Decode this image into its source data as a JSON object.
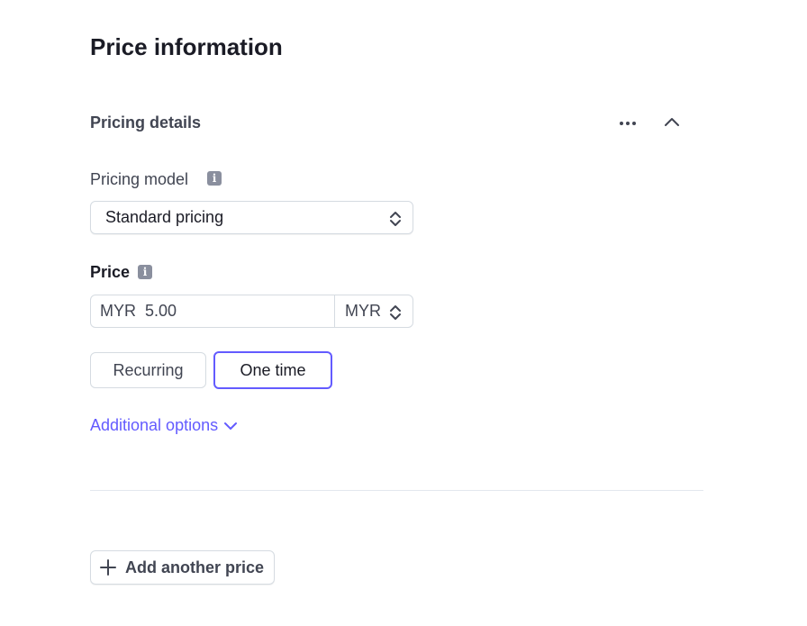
{
  "page": {
    "title": "Price information"
  },
  "pricing_details": {
    "title": "Pricing details",
    "more_icon": "ellipsis-icon",
    "collapse_icon": "chevron-up-icon"
  },
  "pricing_model": {
    "label": "Pricing model",
    "info_icon": "info-icon",
    "selected": "Standard pricing"
  },
  "price": {
    "label": "Price",
    "info_icon": "info-icon",
    "currency_prefix": "MYR",
    "amount": "5.00",
    "currency_selected": "MYR"
  },
  "billing_type": {
    "options": [
      "Recurring",
      "One time"
    ],
    "selected": "One time"
  },
  "additional_options": {
    "label": "Additional options"
  },
  "add_price": {
    "label": "Add another price"
  },
  "colors": {
    "accent": "#635bff",
    "border": "#d5dbe1",
    "text": "#414552"
  }
}
